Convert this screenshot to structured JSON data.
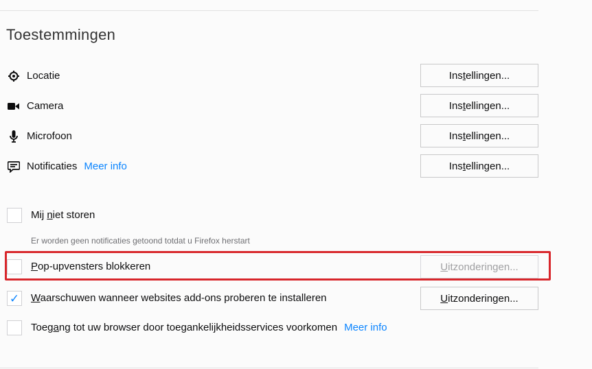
{
  "section": {
    "title": "Toestemmingen"
  },
  "permissions": [
    {
      "label": "Locatie",
      "icon": "location-icon",
      "button": "Instellingen..."
    },
    {
      "label": "Camera",
      "icon": "camera-icon",
      "button": "Instellingen..."
    },
    {
      "label": "Microfoon",
      "icon": "microphone-icon",
      "button": "Instellingen..."
    },
    {
      "label": "Notificaties",
      "icon": "notification-icon",
      "button": "Instellingen...",
      "link": "Meer info"
    }
  ],
  "do_not_disturb": {
    "label": "Mij niet storen",
    "checked": false,
    "note": "Er worden geen notificaties getoond totdat u Firefox herstart"
  },
  "popups": {
    "label": "Pop-upvensters blokkeren",
    "checked": false,
    "button": "Uitzonderingen...",
    "button_disabled": true
  },
  "addons": {
    "label": "Waarschuwen wanneer websites add-ons proberen te installeren",
    "checked": true,
    "button": "Uitzonderingen..."
  },
  "accessibility": {
    "label": "Toegang tot uw browser door toegankelijkheidsservices voorkomen",
    "checked": false,
    "link": "Meer info"
  },
  "colors": {
    "accent": "#0a84ff",
    "highlight": "#d8262b"
  }
}
